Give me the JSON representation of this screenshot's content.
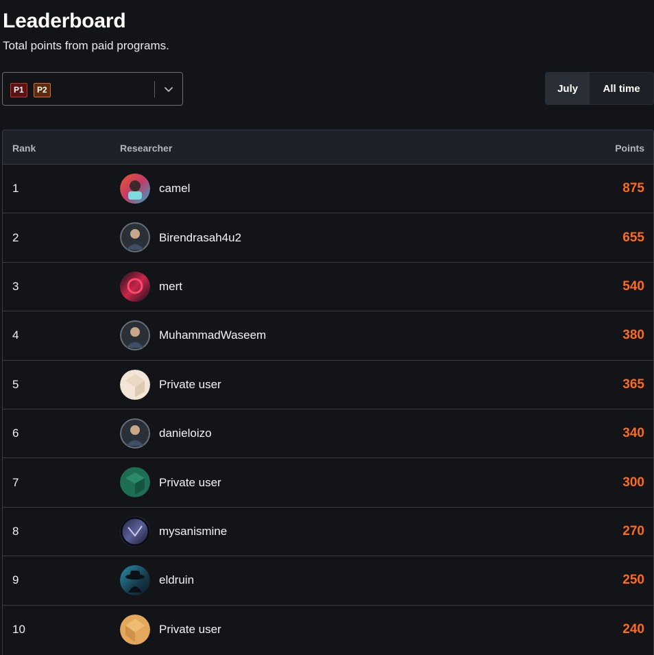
{
  "header": {
    "title": "Leaderboard",
    "subtitle": "Total points from paid programs."
  },
  "filter": {
    "chips": [
      "P1",
      "P2"
    ],
    "icon": "chevron-down-icon"
  },
  "period_toggle": {
    "options": [
      "July",
      "All time"
    ],
    "selected": "July"
  },
  "table": {
    "columns": {
      "rank": "Rank",
      "researcher": "Researcher",
      "points": "Points"
    },
    "rows": [
      {
        "rank": "1",
        "name": "camel",
        "points": "875",
        "avatar": "avatar-camel"
      },
      {
        "rank": "2",
        "name": "Birendrasah4u2",
        "points": "655",
        "avatar": "avatar-photo-man"
      },
      {
        "rank": "3",
        "name": "mert",
        "points": "540",
        "avatar": "avatar-mert"
      },
      {
        "rank": "4",
        "name": "MuhammadWaseem",
        "points": "380",
        "avatar": "avatar-photo-man"
      },
      {
        "rank": "5",
        "name": "Private user",
        "points": "365",
        "avatar": "avatar-private-beige"
      },
      {
        "rank": "6",
        "name": "danieloizo",
        "points": "340",
        "avatar": "avatar-photo-man"
      },
      {
        "rank": "7",
        "name": "Private user",
        "points": "300",
        "avatar": "avatar-private-green"
      },
      {
        "rank": "8",
        "name": "mysanismine",
        "points": "270",
        "avatar": "avatar-anime"
      },
      {
        "rank": "9",
        "name": "eldruin",
        "points": "250",
        "avatar": "avatar-hat"
      },
      {
        "rank": "10",
        "name": "Private user",
        "points": "240",
        "avatar": "avatar-private-gold"
      }
    ]
  },
  "colors": {
    "background": "#121418",
    "points_accent": "#ff6a1c",
    "border": "#3a3e46"
  }
}
